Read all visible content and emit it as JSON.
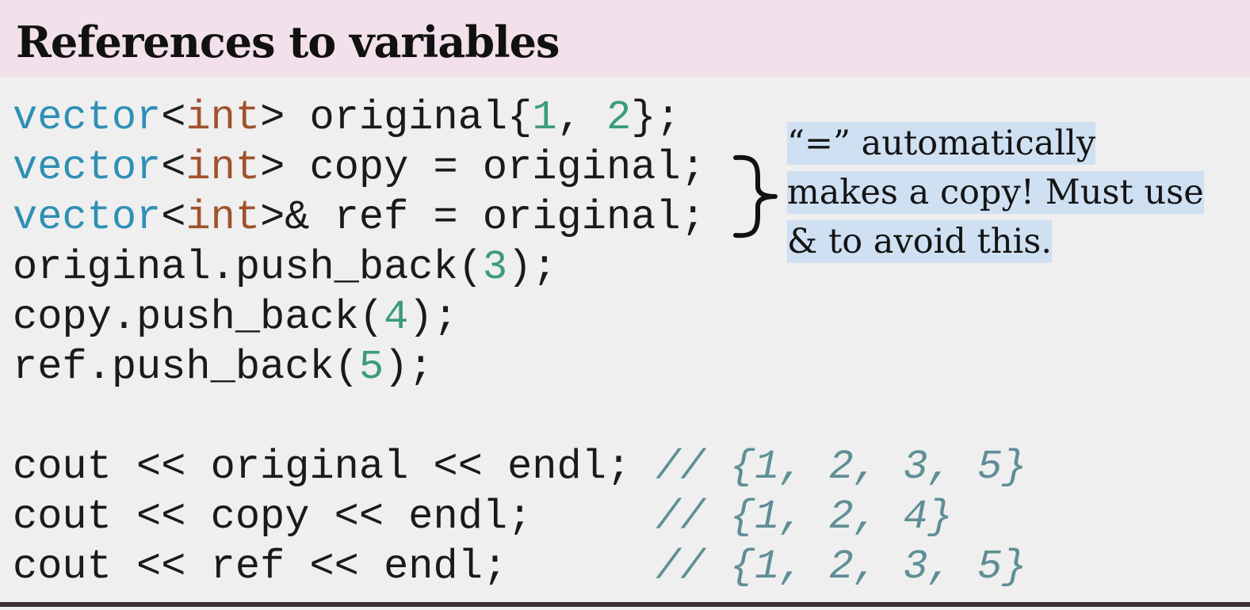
{
  "slide": {
    "title": "References to variables",
    "note": "“=” automatically makes a copy! Must use & to avoid this."
  },
  "code": {
    "line1": {
      "t1": "vector",
      "t2": "<",
      "t3": "int",
      "t4": "> original{",
      "t5": "1",
      "t6": ", ",
      "t7": "2",
      "t8": "};"
    },
    "line2": {
      "t1": "vector",
      "t2": "<",
      "t3": "int",
      "t4": "> copy = original;"
    },
    "line3": {
      "t1": "vector",
      "t2": "<",
      "t3": "int",
      "t4": ">& ref = original;"
    },
    "line4": {
      "t1": "original.push_back(",
      "t2": "3",
      "t3": ");"
    },
    "line5": {
      "t1": "copy.push_back(",
      "t2": "4",
      "t3": ");"
    },
    "line6": {
      "t1": "ref.push_back(",
      "t2": "5",
      "t3": ");"
    },
    "line7": {
      "t1": "cout << original << endl; ",
      "t2": "// {1, 2, 3, 5}"
    },
    "line8": {
      "t1": "cout << copy << endl;     ",
      "t2": "// {1, 2, 4}"
    },
    "line9": {
      "t1": "cout << ref << endl;      ",
      "t2": "// {1, 2, 3, 5}"
    }
  },
  "colors": {
    "header_bg": "#f2e0ea",
    "body_bg": "#efefef",
    "type": "#2f8fb5",
    "keyword": "#a0522d",
    "number": "#3b9c78",
    "comment": "#5f8f96",
    "highlight": "#cfe0f2"
  },
  "icons": {
    "brace": "right-curly-brace-icon"
  }
}
